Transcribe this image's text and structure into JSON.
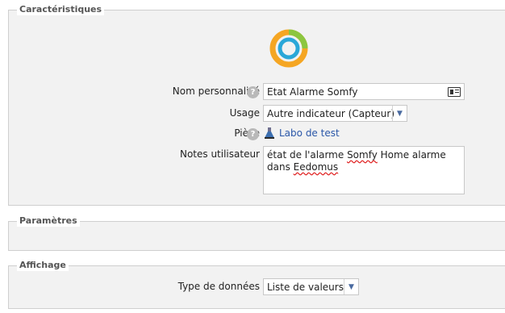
{
  "sections": {
    "caracteristiques": "Caractéristiques",
    "parametres": "Paramètres",
    "affichage": "Affichage"
  },
  "fields": {
    "nom_label": "Nom personnalisé",
    "nom_value": "Etat Alarme Somfy",
    "usage_label": "Usage",
    "usage_value": "Autre indicateur (Capteur)",
    "piece_label": "Pièce",
    "piece_link": "Labo de test",
    "notes_label": "Notes utilisateur",
    "notes_value": {
      "part1": "état de l'alarme ",
      "part2": "Somfy",
      "part3": " Home alarme dans ",
      "part4": "Eedomus"
    },
    "type_label": "Type de données",
    "type_value": "Liste de valeurs"
  },
  "icons": {
    "help": "help-icon",
    "device": "device-status-ring-icon",
    "room": "room-flask-icon",
    "card": "contact-card-icon",
    "dropdown": "chevron-down-icon"
  },
  "colors": {
    "ring_green": "#8cc63f",
    "ring_orange": "#f5a623",
    "ring_blue": "#2aa7d8",
    "link": "#2a57a8"
  }
}
